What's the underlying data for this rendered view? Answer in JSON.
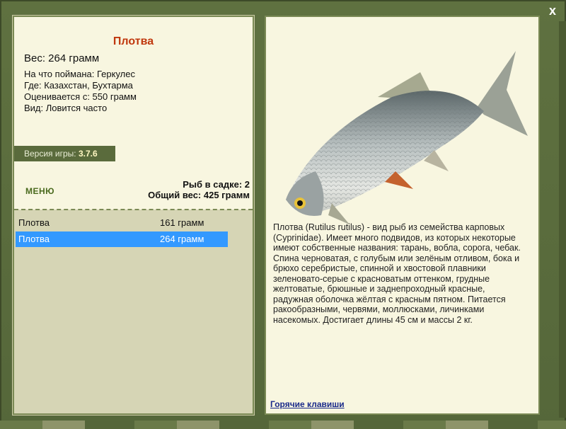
{
  "window": {
    "close_glyph": "x"
  },
  "fish": {
    "title": "Плотва",
    "weight_label": "Вес: 264 грамм",
    "details": [
      "На что поймана: Геркулес",
      "Где: Казахстан, Бухтарма",
      "Оценивается с: 550 грамм",
      "Вид: Ловится часто"
    ]
  },
  "game": {
    "version_label": "Версия игры:",
    "version_value": "3.7.6"
  },
  "menu_label": "МЕНЮ",
  "totals": {
    "fish_in_keepnet": "Рыб в садке: 2",
    "total_weight": "Общий вес: 425 грамм"
  },
  "catch_list": [
    {
      "name": "Плотва",
      "weight": "161 грамм",
      "selected": false
    },
    {
      "name": "Плотва",
      "weight": "264 грамм",
      "selected": true
    }
  ],
  "description": "Плотва (Rutilus rutilus) - вид рыб из семейства карповых (Cyprinidae). Имеет много подвидов, из которых некоторые имеют собственные названия: тарань, вобла, сорога, чебак. Спина черноватая, с голубым или зелёным отливом, бока и брюхо серебристые, спинной и хвостовой плавники зеленовато-серые с красноватым оттенком, грудные желтоватые, брюшные и заднепроходный красные, радужная оболочка жёлтая с красным пятном. Питается ракообразными, червями, моллюсками, личинками насекомых. Достигает длины 45 см и массы 2 кг.",
  "hotkeys_label": "Горячие клавиши",
  "colors": {
    "frame": "#5f7140",
    "panel_bg": "#f8f6e0",
    "title_red": "#c0380e",
    "selection_blue": "#3399ff"
  }
}
